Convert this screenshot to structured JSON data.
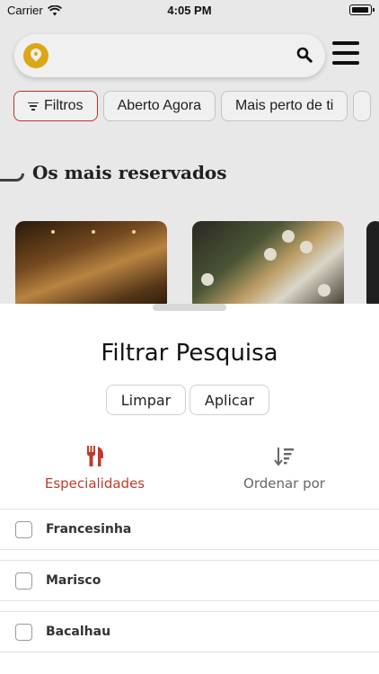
{
  "status_bar": {
    "carrier": "Carrier",
    "time": "4:05 PM"
  },
  "filters": [
    {
      "label": "Filtros",
      "active": true
    },
    {
      "label": "Aberto Agora",
      "active": false
    },
    {
      "label": "Mais perto de ti",
      "active": false
    },
    {
      "label": "",
      "active": false
    }
  ],
  "section": {
    "title": "Os mais reservados"
  },
  "sheet": {
    "title": "Filtrar Pesquisa",
    "clear_label": "Limpar",
    "apply_label": "Aplicar",
    "tabs": [
      {
        "label": "Especialidades",
        "icon": "utensils-icon",
        "selected": true
      },
      {
        "label": "Ordenar por",
        "icon": "sort-icon",
        "selected": false
      }
    ],
    "options": [
      {
        "label": "Francesinha",
        "checked": false
      },
      {
        "label": "Marisco",
        "checked": false
      },
      {
        "label": "Bacalhau",
        "checked": false
      }
    ]
  },
  "colors": {
    "accent": "#c0392b",
    "pin": "#e9b21b",
    "muted_text": "#666666"
  }
}
